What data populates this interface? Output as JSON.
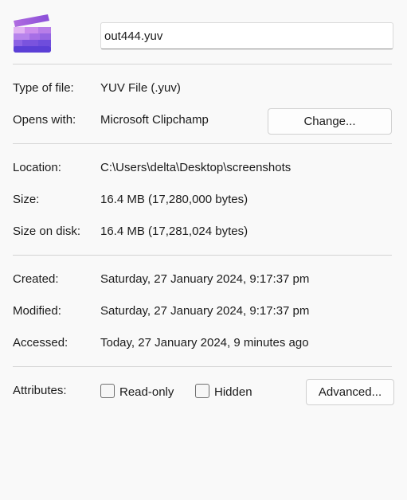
{
  "file": {
    "name": "out444.yuv",
    "icon": "clipchamp-clapperboard-icon"
  },
  "details": {
    "type_label": "Type of file:",
    "type_value": "YUV File (.yuv)",
    "opens_label": "Opens with:",
    "opens_value": "Microsoft Clipchamp",
    "change_button": "Change...",
    "location_label": "Location:",
    "location_value": "C:\\Users\\delta\\Desktop\\screenshots",
    "size_label": "Size:",
    "size_value": "16.4 MB (17,280,000 bytes)",
    "size_on_disk_label": "Size on disk:",
    "size_on_disk_value": "16.4 MB (17,281,024 bytes)",
    "created_label": "Created:",
    "created_value": "Saturday, 27 January 2024, 9:17:37 pm",
    "modified_label": "Modified:",
    "modified_value": "Saturday, 27 January 2024, 9:17:37 pm",
    "accessed_label": "Accessed:",
    "accessed_value": "Today, 27 January 2024, 9 minutes ago"
  },
  "attributes": {
    "label": "Attributes:",
    "read_only_label": "Read-only",
    "read_only_checked": false,
    "hidden_label": "Hidden",
    "hidden_checked": false,
    "advanced_button": "Advanced..."
  },
  "colors": {
    "background": "#f9f9f9",
    "separator": "#d4d4d4",
    "icon_purple_light": "#c98ee8",
    "icon_purple_dark": "#5b3fd6"
  }
}
